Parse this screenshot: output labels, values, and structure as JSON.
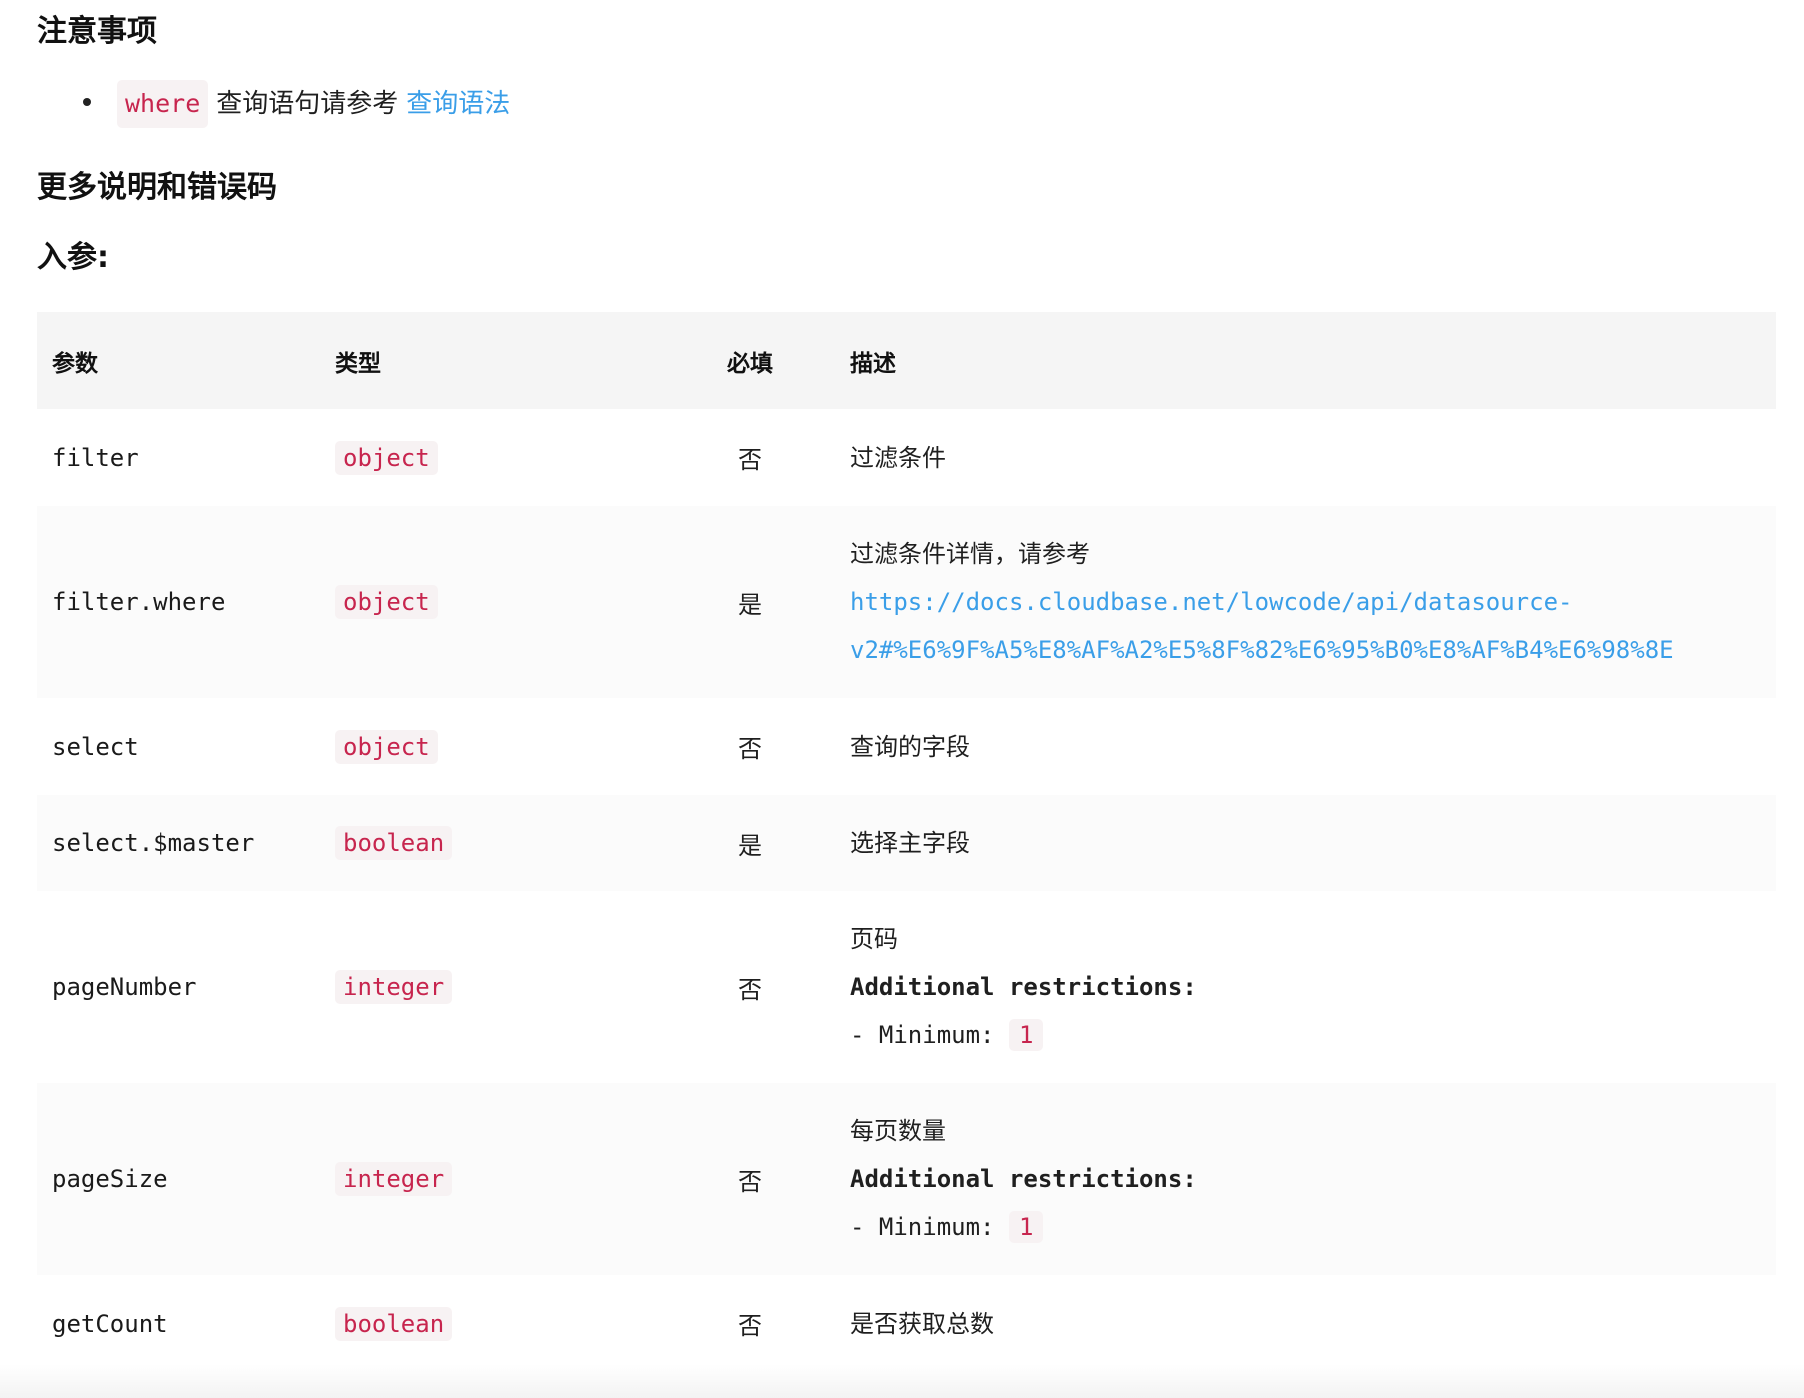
{
  "notes": {
    "title": "注意事项",
    "items": [
      {
        "code": "where",
        "text": "查询语句请参考",
        "link": "查询语法"
      }
    ]
  },
  "more": {
    "title": "更多说明和错误码"
  },
  "params": {
    "title": "入参:",
    "headers": {
      "param": "参数",
      "type": "类型",
      "required": "必填",
      "description": "描述"
    },
    "rows": [
      {
        "param": "filter",
        "type": "object",
        "required": "否",
        "desc": "过滤条件"
      },
      {
        "param": "filter.where",
        "type": "object",
        "required": "是",
        "desc": "过滤条件详情，请参考",
        "url1": "https://docs.cloudbase.net/lowcode/api/datasource-",
        "url2": "v2#%E6%9F%A5%E8%AF%A2%E5%8F%82%E6%95%B0%E8%AF%B4%E6%98%8E"
      },
      {
        "param": "select",
        "type": "object",
        "required": "否",
        "desc": "查询的字段"
      },
      {
        "param": "select.$master",
        "type": "boolean",
        "required": "是",
        "desc": "选择主字段"
      },
      {
        "param": "pageNumber",
        "type": "integer",
        "required": "否",
        "desc": "页码",
        "restrictions": "Additional restrictions:",
        "min_label": "- Minimum:",
        "min_value": "1"
      },
      {
        "param": "pageSize",
        "type": "integer",
        "required": "否",
        "desc": "每页数量",
        "restrictions": "Additional restrictions:",
        "min_label": "- Minimum:",
        "min_value": "1"
      },
      {
        "param": "getCount",
        "type": "boolean",
        "required": "否",
        "desc": "是否获取总数"
      }
    ]
  }
}
